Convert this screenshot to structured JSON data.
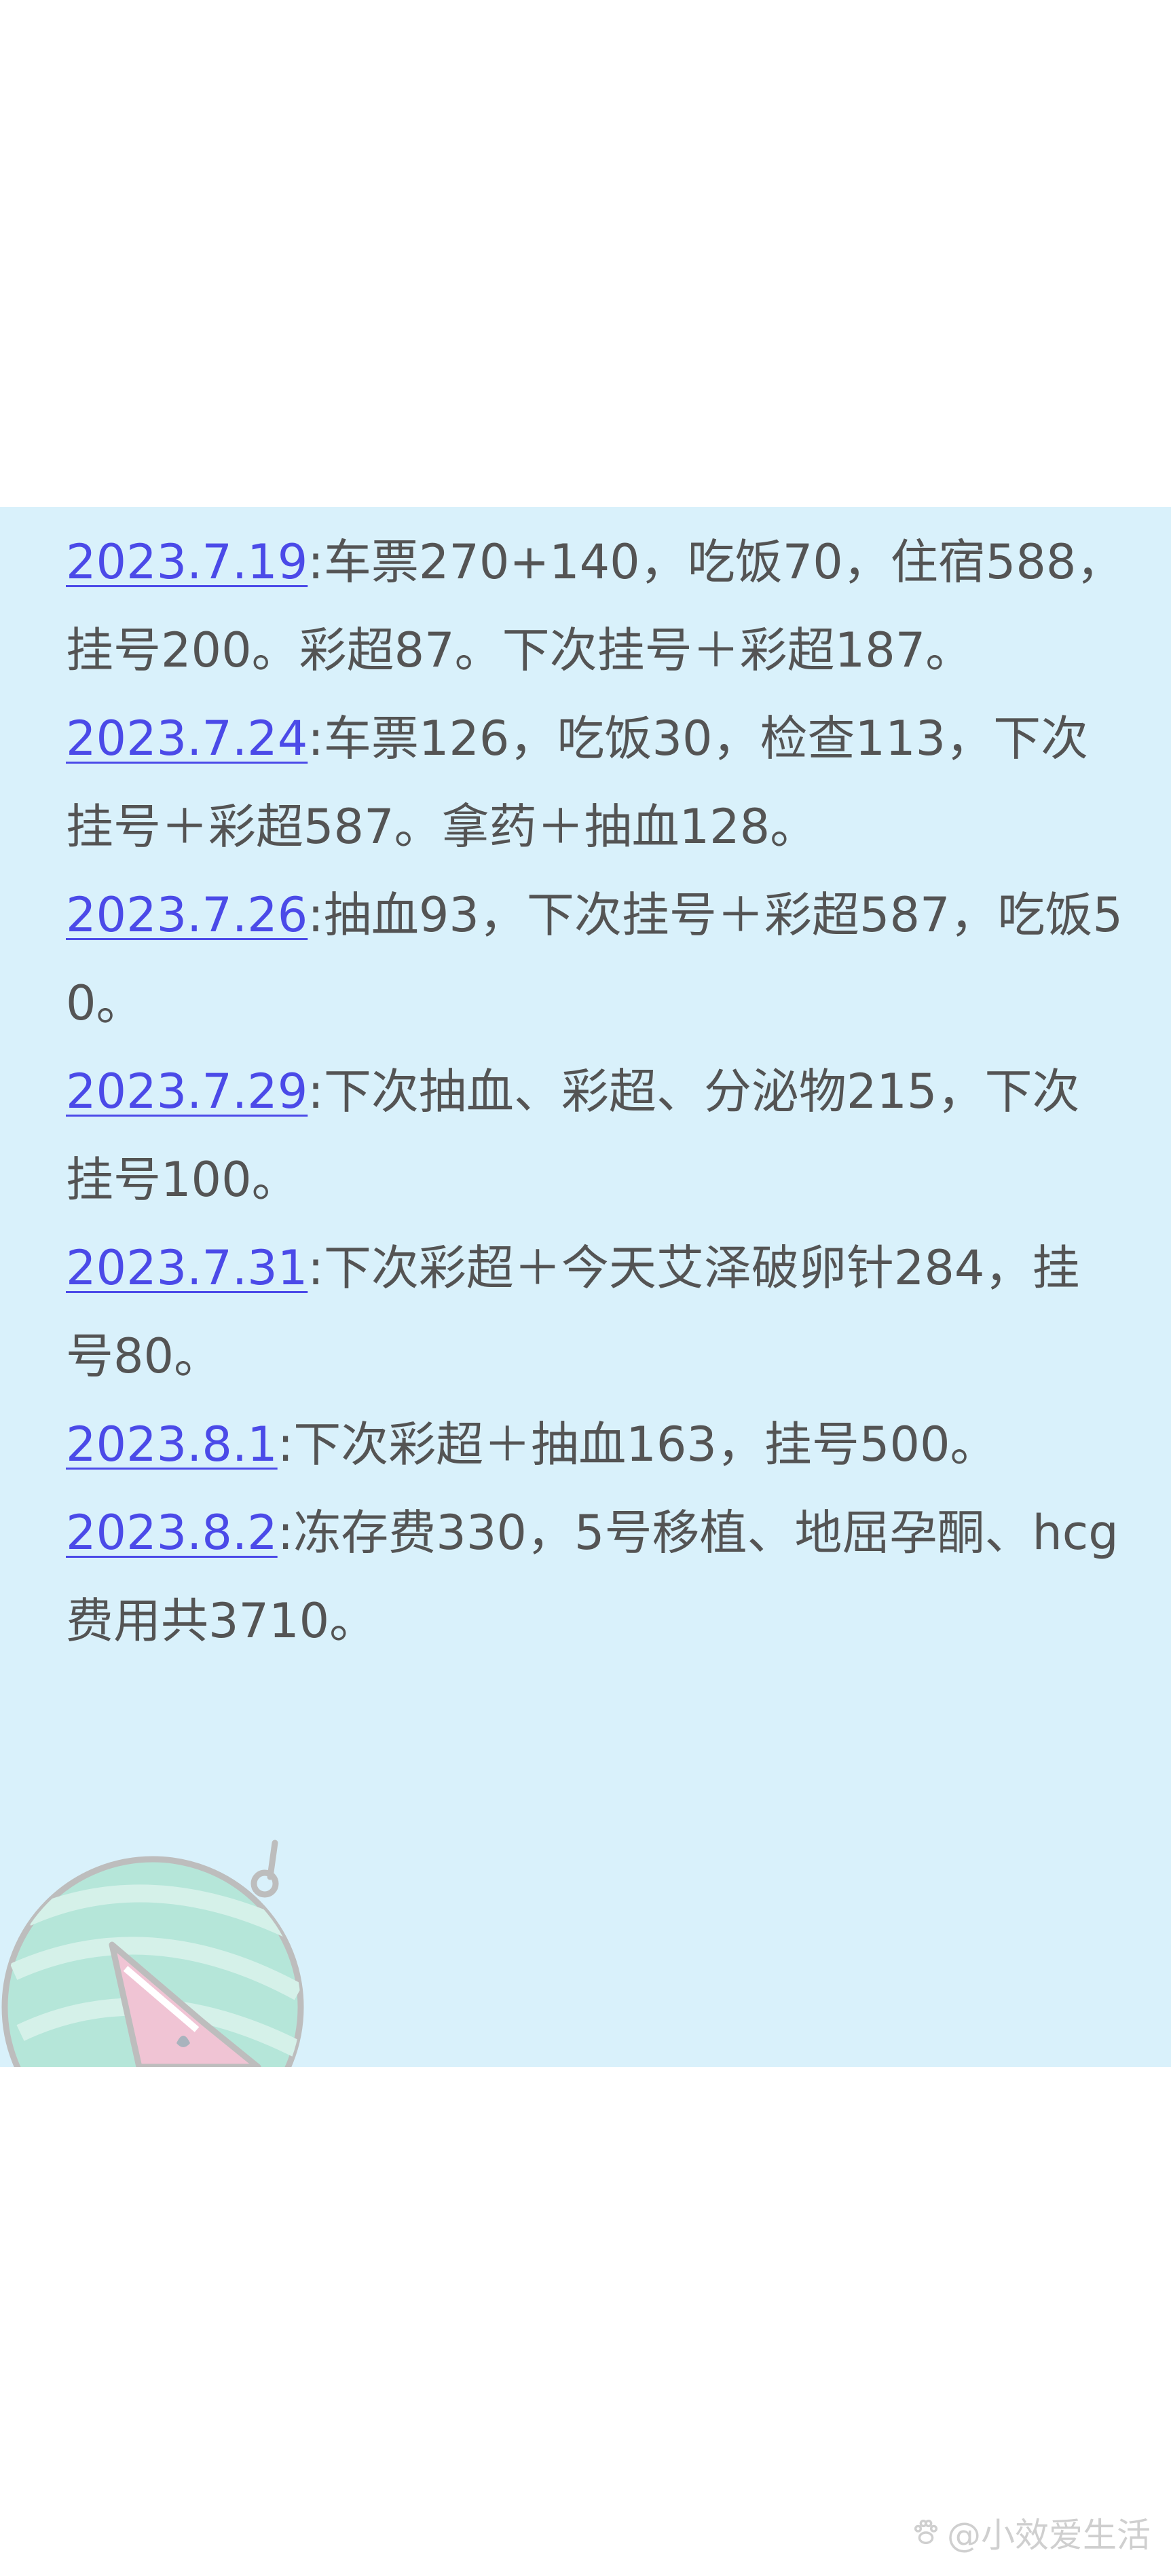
{
  "entries": [
    {
      "date": "2023.7.19",
      "text": ":车票270+140，吃饭70，住宿588，挂号200。彩超87。下次挂号＋彩超187。"
    },
    {
      "date": "2023.7.24",
      "text": ":车票126，吃饭30，检查113，下次挂号＋彩超587。拿药＋抽血128。"
    },
    {
      "date": "2023.7.26",
      "text": ":抽血93，下次挂号＋彩超587，吃饭50。"
    },
    {
      "date": "2023.7.29",
      "text": ":下次抽血、彩超、分泌物215，下次挂号100。"
    },
    {
      "date": "2023.7.31",
      "text": ":下次彩超＋今天艾泽破卵针284，挂号80。"
    },
    {
      "date": "2023.8.1",
      "text": ":下次彩超＋抽血163，挂号500。"
    },
    {
      "date": "2023.8.2",
      "text": ":冻存费330，5号移植、地屈孕酮、hcg费用共3710。"
    }
  ],
  "decoration": {
    "icon": "watermelon-icon"
  },
  "watermark": {
    "icon": "paw-icon",
    "text": "@小效爱生活"
  },
  "colors": {
    "card_background": "#d9f1fb",
    "date_link": "#4b4ae8",
    "body_text": "#545454",
    "watermark": "#cfcfcf"
  }
}
